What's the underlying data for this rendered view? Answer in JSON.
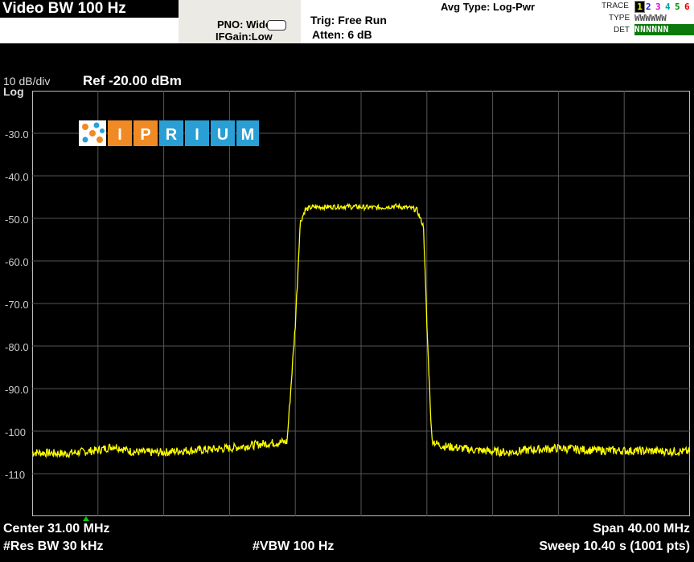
{
  "header": {
    "title": "Video BW 100 Hz",
    "pno": "PNO: Wide",
    "ifgain": "IFGain:Low",
    "trig": "Trig: Free Run",
    "atten": "Atten: 6 dB",
    "avg_type": "Avg Type: Log-Pwr"
  },
  "trace_panel": {
    "trace_label": "TRACE",
    "type_label": "TYPE",
    "det_label": "DET",
    "traces": [
      "1",
      "2",
      "3",
      "4",
      "5",
      "6"
    ],
    "trace_colors": [
      "#c9c900",
      "#2222dd",
      "#dd00dd",
      "#00a0a0",
      "#008800",
      "#dd0000"
    ],
    "type_value": "WWWWWW",
    "det_value": "NNNNNN"
  },
  "display": {
    "scale": "10 dB/div",
    "scale_type": "Log",
    "ref_level": "Ref -20.00 dBm",
    "y_ticks": [
      "-30.0",
      "-40.0",
      "-50.0",
      "-60.0",
      "-70.0",
      "-80.0",
      "-90.0",
      "-100",
      "-110"
    ]
  },
  "logo": {
    "letters": [
      "I",
      "P",
      "R",
      "I",
      "U",
      "M"
    ],
    "colors": [
      "#f08a24",
      "#f08a24",
      "#2a9fd6",
      "#2a9fd6",
      "#2a9fd6",
      "#2a9fd6"
    ]
  },
  "footer": {
    "center": "Center 31.00 MHz",
    "span": "Span 40.00 MHz",
    "res_bw": "#Res BW 30 kHz",
    "vbw": "#VBW 100 Hz",
    "sweep": "Sweep  10.40 s (1001 pts)"
  },
  "chart_data": {
    "type": "line",
    "x_center_mhz": 31.0,
    "x_span_mhz": 40.0,
    "ylim": [
      -120,
      -20
    ],
    "trace_color": "#ffff00",
    "grid": true,
    "series": [
      {
        "x": [
          11,
          13,
          15,
          16,
          17,
          18,
          19,
          20,
          21,
          23,
          25,
          26.5,
          27,
          27.3,
          27.6,
          28,
          30,
          32,
          33,
          34,
          34.4,
          34.8,
          35.0,
          35.3,
          35.6,
          36,
          38,
          40,
          41,
          43,
          45,
          47,
          49,
          51
        ],
        "y": [
          -105,
          -105.3,
          -104.5,
          -103.5,
          -104.8,
          -105,
          -105,
          -104.6,
          -104.5,
          -104,
          -103,
          -102.5,
          -75,
          -51,
          -48,
          -47.4,
          -47.2,
          -47.5,
          -47.1,
          -47.6,
          -48,
          -52,
          -75,
          -102,
          -103,
          -103.5,
          -104.5,
          -105,
          -104.5,
          -104,
          -104.5,
          -104.6,
          -104.7,
          -104.8
        ]
      }
    ]
  }
}
